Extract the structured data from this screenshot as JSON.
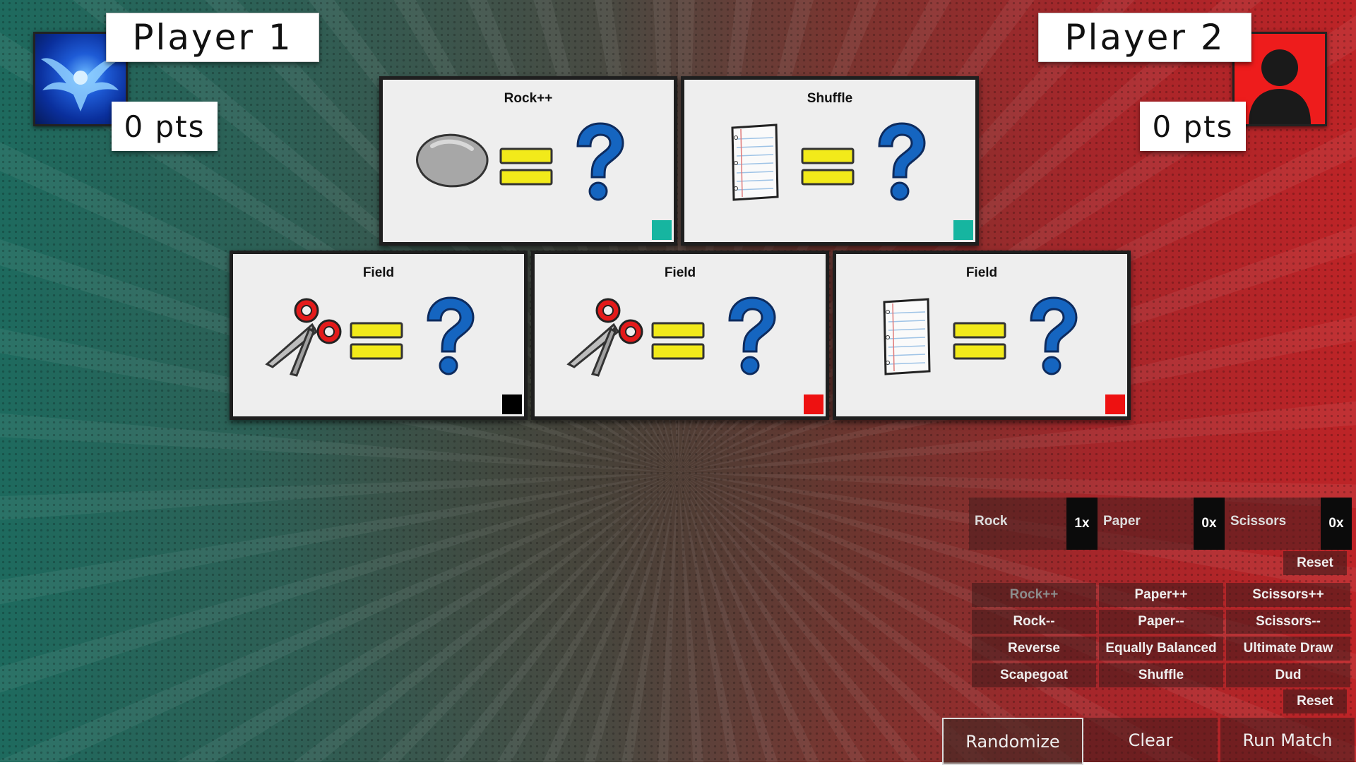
{
  "player1": {
    "name": "Player 1",
    "points": "0 pts"
  },
  "player2": {
    "name": "Player 2",
    "points": "0 pts"
  },
  "cards": [
    {
      "title": "Rock++",
      "icon": "rock-icon",
      "marker_color": "#16b5a0"
    },
    {
      "title": "Shuffle",
      "icon": "paper-icon",
      "marker_color": "#16b5a0"
    },
    {
      "title": "Field",
      "icon": "scissors-icon",
      "marker_color": "#000000"
    },
    {
      "title": "Field",
      "icon": "scissors-icon",
      "marker_color": "#ee1111"
    },
    {
      "title": "Field",
      "icon": "paper-icon",
      "marker_color": "#ee1111"
    }
  ],
  "moves": [
    {
      "label": "Rock",
      "count": "1x"
    },
    {
      "label": "Paper",
      "count": "0x"
    },
    {
      "label": "Scissors",
      "count": "0x"
    }
  ],
  "reset_label": "Reset",
  "card_buttons": [
    {
      "label": "Rock++",
      "disabled": true
    },
    {
      "label": "Paper++"
    },
    {
      "label": "Scissors++"
    },
    {
      "label": "Rock--"
    },
    {
      "label": "Paper--"
    },
    {
      "label": "Scissors--"
    },
    {
      "label": "Reverse"
    },
    {
      "label": "Equally Balanced"
    },
    {
      "label": "Ultimate Draw"
    },
    {
      "label": "Scapegoat"
    },
    {
      "label": "Shuffle"
    },
    {
      "label": "Dud"
    }
  ],
  "actions": {
    "randomize": "Randomize",
    "clear": "Clear",
    "run_match": "Run Match"
  },
  "colors": {
    "equals": "#f2ea1a",
    "question": "#1565c0",
    "teal_marker": "#16b5a0",
    "red_marker": "#ee1111"
  }
}
